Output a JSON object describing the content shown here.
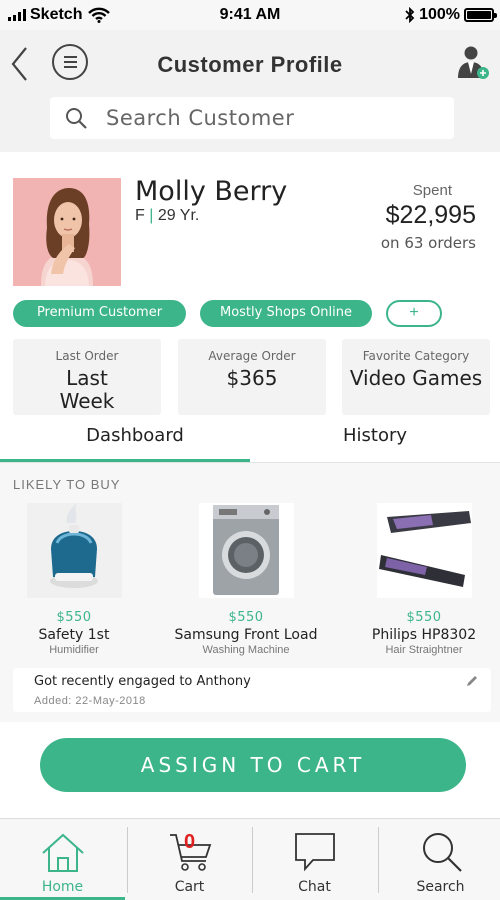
{
  "status_bar": {
    "carrier": "Sketch",
    "time": "9:41 AM",
    "battery": "100%"
  },
  "header": {
    "title": "Customer Profile",
    "search_placeholder": "Search Customer"
  },
  "customer": {
    "name": "Molly Berry",
    "gender": "F",
    "age": "29 Yr.",
    "spent_label": "Spent",
    "spent_value": "$22,995",
    "orders": "on 63 orders"
  },
  "tags": {
    "premium": "Premium Customer",
    "shopping": "Mostly Shops Online",
    "add": "+"
  },
  "stats": [
    {
      "label": "Last Order",
      "value": "Last Week"
    },
    {
      "label": "Average Order",
      "value": "$365"
    },
    {
      "label": "Favorite Category",
      "value": "Video Games"
    }
  ],
  "tabs": {
    "dashboard": "Dashboard",
    "history": "History"
  },
  "likely_to_buy": {
    "title": "LIKELY TO BUY",
    "products": [
      {
        "price": "$550",
        "name": "Safety 1st",
        "category": "Humidifier",
        "icon": "humidifier-image"
      },
      {
        "price": "$550",
        "name": "Samsung Front Load",
        "category": "Washing Machine",
        "icon": "washing-machine-image"
      },
      {
        "price": "$550",
        "name": "Philips HP8302",
        "category": "Hair Straightner",
        "icon": "hair-straightener-image"
      }
    ]
  },
  "note": {
    "text": "Got recently engaged to Anthony",
    "date": "Added: 22-May-2018"
  },
  "cta": {
    "label": "ASSIGN TO CART"
  },
  "tabbar": {
    "home": "Home",
    "cart": "Cart",
    "cart_count": "0",
    "chat": "Chat",
    "search": "Search"
  },
  "colors": {
    "accent": "#3db58b",
    "cart_badge": "#e02020"
  }
}
